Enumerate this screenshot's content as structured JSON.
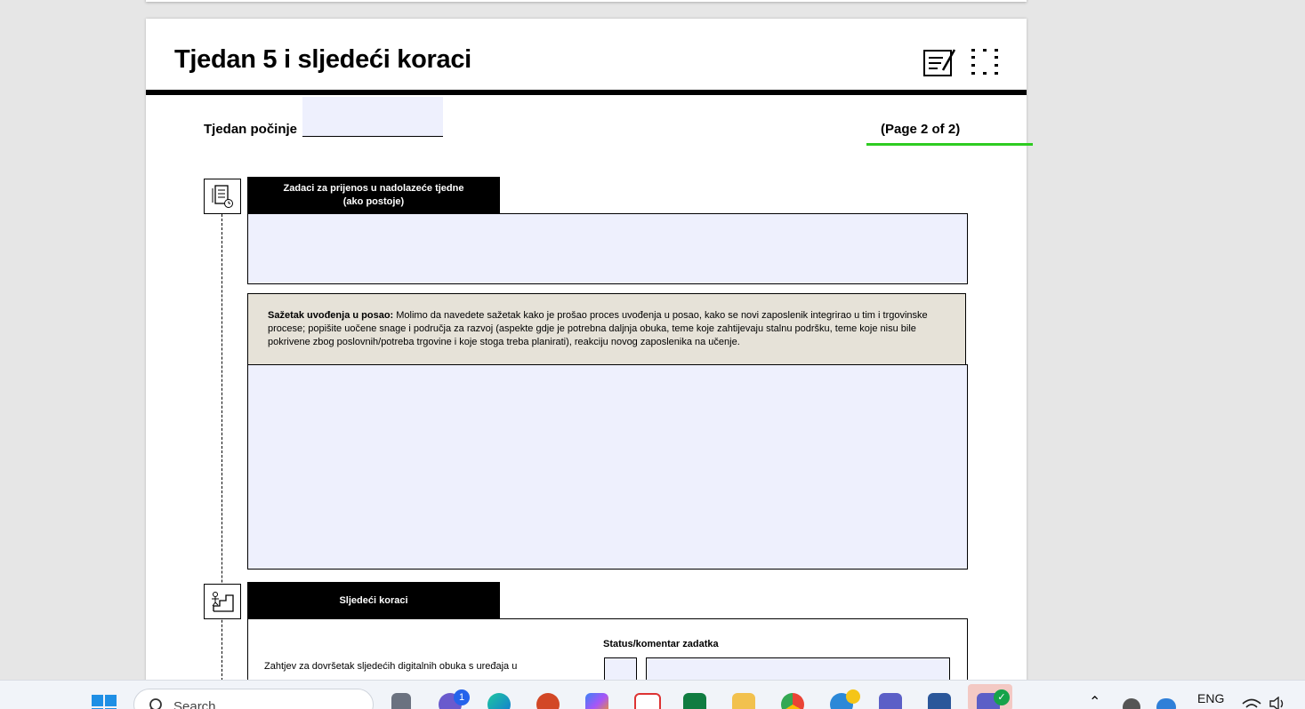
{
  "document": {
    "title": "Tjedan 5 i sljedeći koraci",
    "week_label": "Tjedan počinje",
    "page_number": "(Page 2 of 2)",
    "section1": {
      "title_line1": "Zadaci za prijenos u nadolazeće tjedne",
      "title_line2": "(ako postoje)"
    },
    "summary": {
      "bold": "Sažetak uvođenja u posao:",
      "text": " Molimo da navedete sažetak kako je prošao proces uvođenja u posao, kako se novi zaposlenik integrirao u tim i trgovinske procese; popišite uočene snage i područja za razvoj (aspekte gdje je potrebna daljnja obuka, teme koje zahtijevaju stalnu podršku, teme koje nisu bile pokrivene zbog poslovnih/potreba trgovine i koje stoga treba planirati), reakciju novog zaposlenika na učenje."
    },
    "section2": {
      "title": "Sljedeći koraci",
      "status_label": "Status/komentar zadatka",
      "task_text": "Zahtjev za dovršetak sljedećih digitalnih obuka s uređaja u"
    }
  },
  "taskbar": {
    "search_placeholder": "Search",
    "language": "ENG",
    "chat_badge": "1",
    "apps": [
      "windows-start",
      "search",
      "file-explorer-task",
      "teams-chat",
      "edge",
      "powerpoint",
      "copilot",
      "snipping-tool",
      "excel",
      "file-explorer",
      "chrome",
      "quick-assist",
      "teams",
      "word",
      "teams-work"
    ]
  },
  "colors": {
    "field_fill": "#eef0fd",
    "summary_fill": "#e6e2d8",
    "focus_line": "#2ecc21",
    "header_black": "#000000"
  }
}
